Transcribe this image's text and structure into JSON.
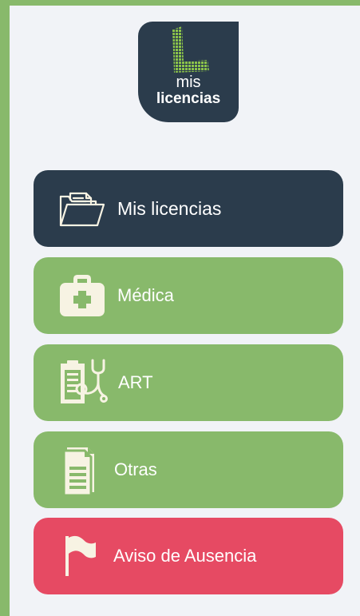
{
  "logo": {
    "line1": "mis",
    "line2": "licencias",
    "letter": "L"
  },
  "menu": {
    "items": [
      {
        "label": "Mis licencias",
        "icon": "folder-documents-icon",
        "color": "#2b3c4c"
      },
      {
        "label": "Médica",
        "icon": "first-aid-kit-icon",
        "color": "#88b96b"
      },
      {
        "label": "ART",
        "icon": "clipboard-stethoscope-icon",
        "color": "#88b96b"
      },
      {
        "label": "Otras",
        "icon": "documents-icon",
        "color": "#88b96b"
      },
      {
        "label": "Aviso de Ausencia",
        "icon": "flag-icon",
        "color": "#e64a63"
      }
    ]
  },
  "colors": {
    "background": "#f1f3f7",
    "frame": "#88b96b",
    "dark": "#2b3c4c",
    "green": "#88b96b",
    "red": "#e64a63",
    "icon": "#f7f3e3"
  }
}
